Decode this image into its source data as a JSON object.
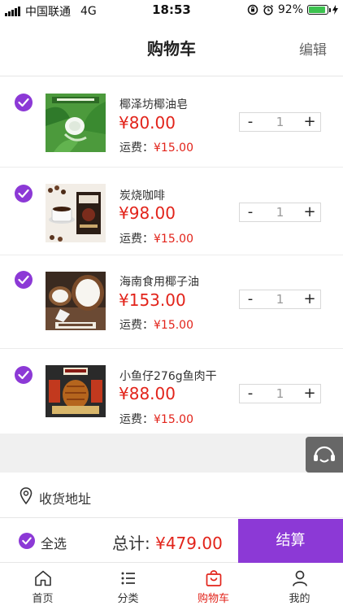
{
  "status_bar": {
    "carrier": "中国联通",
    "network": "4G",
    "time": "18:53",
    "battery": "92%"
  },
  "header": {
    "title": "购物车",
    "edit_label": "编辑"
  },
  "items": [
    {
      "name": "椰泽坊椰油皂",
      "price": "¥80.00",
      "shipping_label": "运费：",
      "shipping_fee": "¥15.00",
      "quantity": "1",
      "minus": "-",
      "plus": "+",
      "checked": true
    },
    {
      "name": "炭烧咖啡",
      "price": "¥98.00",
      "shipping_label": "运费：",
      "shipping_fee": "¥15.00",
      "quantity": "1",
      "minus": "-",
      "plus": "+",
      "checked": true
    },
    {
      "name": "海南食用椰子油",
      "price": "¥153.00",
      "shipping_label": "运费：",
      "shipping_fee": "¥15.00",
      "quantity": "1",
      "minus": "-",
      "plus": "+",
      "checked": true
    },
    {
      "name": "小鱼仔276g鱼肉干",
      "price": "¥88.00",
      "shipping_label": "运费：",
      "shipping_fee": "¥15.00",
      "quantity": "1",
      "minus": "-",
      "plus": "+",
      "checked": true
    }
  ],
  "address": {
    "label": "收货地址"
  },
  "checkout": {
    "select_all_label": "全选",
    "total_label": "总计: ",
    "total_amount": "¥479.00",
    "button_label": "结算"
  },
  "tabs": [
    {
      "label": "首页",
      "icon": "home-icon",
      "active": false
    },
    {
      "label": "分类",
      "icon": "list-icon",
      "active": false
    },
    {
      "label": "购物车",
      "icon": "bag-icon",
      "active": true
    },
    {
      "label": "我的",
      "icon": "user-icon",
      "active": false
    }
  ],
  "colors": {
    "accent": "#8c39d6",
    "price": "#e2231a",
    "battery": "#3cc24f"
  }
}
